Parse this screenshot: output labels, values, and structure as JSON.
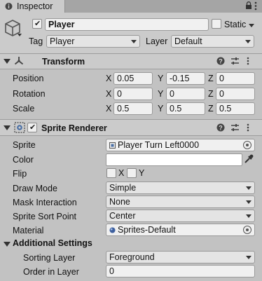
{
  "window": {
    "tab_title": "Inspector"
  },
  "gameobject": {
    "active": true,
    "name": "Player",
    "static_label": "Static",
    "static_checked": false,
    "tag_label": "Tag",
    "tag_value": "Player",
    "layer_label": "Layer",
    "layer_value": "Default"
  },
  "transform": {
    "title": "Transform",
    "rows": [
      {
        "label": "Position",
        "x": "0.05",
        "y": "-0.15",
        "z": "0"
      },
      {
        "label": "Rotation",
        "x": "0",
        "y": "0",
        "z": "0"
      },
      {
        "label": "Scale",
        "x": "0.5",
        "y": "0.5",
        "z": "0.5"
      }
    ],
    "axis": {
      "x": "X",
      "y": "Y",
      "z": "Z"
    }
  },
  "sprite_renderer": {
    "title": "Sprite Renderer",
    "enabled": true,
    "sprite_label": "Sprite",
    "sprite_value": "Player Turn Left0000",
    "color_label": "Color",
    "color_value": "#ffffff",
    "flip_label": "Flip",
    "flip_x_label": "X",
    "flip_y_label": "Y",
    "draw_mode_label": "Draw Mode",
    "draw_mode_value": "Simple",
    "mask_label": "Mask Interaction",
    "mask_value": "None",
    "sort_point_label": "Sprite Sort Point",
    "sort_point_value": "Center",
    "material_label": "Material",
    "material_value": "Sprites-Default",
    "additional_settings": "Additional Settings",
    "sorting_layer_label": "Sorting Layer",
    "sorting_layer_value": "Foreground",
    "order_label": "Order in Layer",
    "order_value": "0"
  },
  "icons": {
    "tab": "inspector-tab-icon",
    "menu": "kebab-menu-icon",
    "gameobject": "cube-icon",
    "transform": "transform-axes-icon",
    "sprite_renderer": "sprite-renderer-icon",
    "help": "help-icon",
    "presets": "presets-slider-icon",
    "context": "context-menu-icon"
  }
}
